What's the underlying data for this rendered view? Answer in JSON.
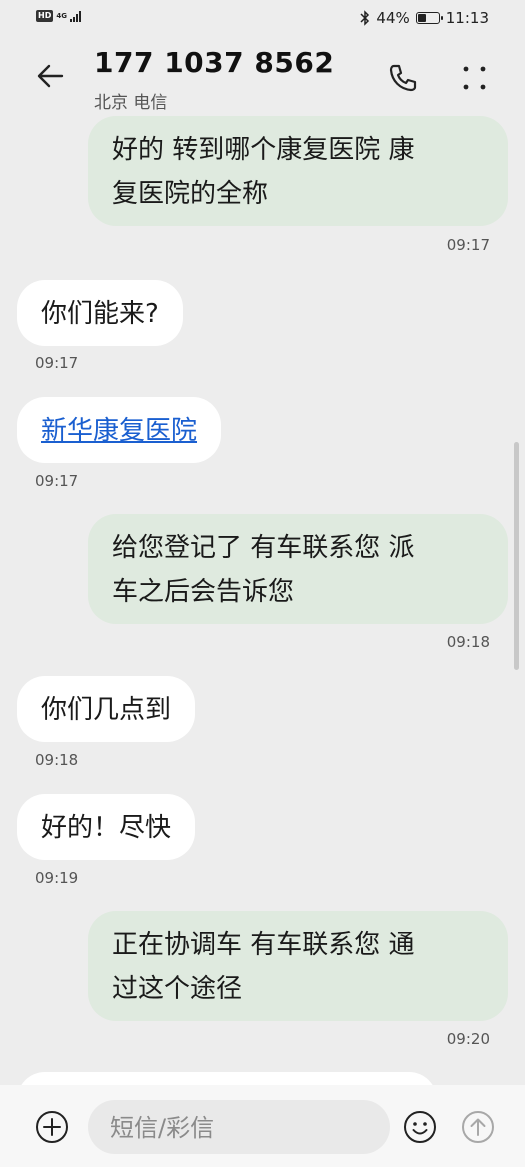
{
  "status_bar": {
    "hd": "HD",
    "network": "4G",
    "battery_text": "44%",
    "battery_level": 0.44,
    "time": "11:13"
  },
  "header": {
    "contact_number": "177 1037 8562",
    "contact_location": "北京 电信"
  },
  "messages": [
    {
      "direction": "out",
      "text_lines": [
        "好的 转到哪个康复医院 康",
        "复医院的全称"
      ],
      "time": "09:17"
    },
    {
      "direction": "in",
      "text_lines": [
        "你们能来?"
      ],
      "time": "09:17"
    },
    {
      "direction": "in",
      "text_lines": [
        "新华康复医院"
      ],
      "time": "09:17",
      "is_link": true
    },
    {
      "direction": "out",
      "text_lines": [
        "给您登记了 有车联系您 派",
        "车之后会告诉您"
      ],
      "time": "09:18"
    },
    {
      "direction": "in",
      "text_lines": [
        "你们几点到"
      ],
      "time": "09:18"
    },
    {
      "direction": "in",
      "text_lines": [
        "好的！尽快"
      ],
      "time": "09:19"
    },
    {
      "direction": "out",
      "text_lines": [
        "正在协调车 有车联系您 通",
        "过这个途径"
      ],
      "time": "09:20"
    }
  ],
  "composer": {
    "placeholder": "短信/彩信"
  },
  "icons": {
    "back": "arrow-left-icon",
    "call": "phone-icon",
    "more": "more-vertical-icon",
    "add": "plus-circle-icon",
    "emoji": "smiley-icon",
    "send": "arrow-up-circle-icon"
  },
  "colors": {
    "background": "#ededed",
    "outgoing_bubble": "#dfeadf",
    "incoming_bubble": "#ffffff",
    "link": "#1a5fd0"
  }
}
